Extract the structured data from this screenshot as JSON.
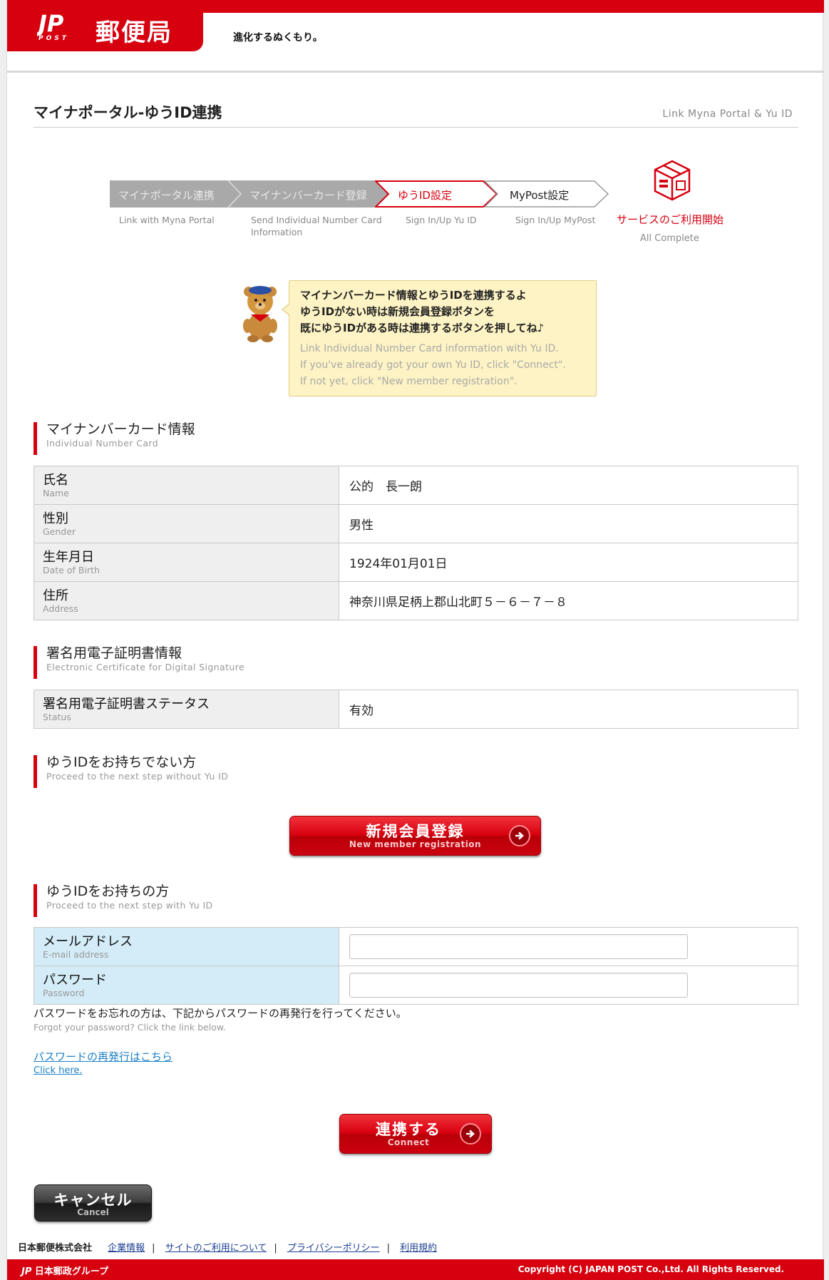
{
  "header": {
    "logo_mark": "JP",
    "logo_post": "POST",
    "brand": "郵便局",
    "slogan": "進化するぬくもり。"
  },
  "page": {
    "title": "マイナポータル-ゆうID連携",
    "subtitle": "Link Myna Portal & Yu ID"
  },
  "steps": [
    {
      "label": "マイナポータル連携",
      "sub": "Link with Myna Portal",
      "state": "done"
    },
    {
      "label": "マイナンバーカード登録",
      "sub": "Send Individual Number Card Information",
      "state": "done"
    },
    {
      "label": "ゆうID設定",
      "sub": "Sign In/Up Yu ID",
      "state": "current"
    },
    {
      "label": "MyPost設定",
      "sub": "Sign In/Up MyPost",
      "state": "todo"
    }
  ],
  "final_step": {
    "label": "サービスのご利用開始",
    "sub": "All Complete"
  },
  "bubble": {
    "jp": [
      "マイナンバーカード情報とゆうIDを連携するよ",
      "ゆうIDがない時は新規会員登録ボタンを",
      "既にゆうIDがある時は連携するボタンを押してね♪"
    ],
    "en": [
      "Link Individual Number Card information with Yu ID.",
      "If you've already got your own Yu ID, click \"Connect\".",
      "If not yet, click \"New member registration\"."
    ]
  },
  "card_section": {
    "title": "マイナンバーカード情報",
    "title_en": "Individual Number Card",
    "rows": [
      {
        "label": "氏名",
        "label_en": "Name",
        "value": "公的　長一朗"
      },
      {
        "label": "性別",
        "label_en": "Gender",
        "value": "男性"
      },
      {
        "label": "生年月日",
        "label_en": "Date of Birth",
        "value": "1924年01月01日"
      },
      {
        "label": "住所",
        "label_en": "Address",
        "value": "神奈川県足柄上郡山北町５－６－７－８"
      }
    ]
  },
  "cert_section": {
    "title": "署名用電子証明書情報",
    "title_en": "Electronic Certificate for Digital Signature",
    "rows": [
      {
        "label": "署名用電子証明書ステータス",
        "label_en": "Status",
        "value": "有効"
      }
    ]
  },
  "no_id_section": {
    "title": "ゆうIDをお持ちでない方",
    "title_en": "Proceed to the next step without Yu ID",
    "button_jp": "新規会員登録",
    "button_en": "New member registration"
  },
  "has_id_section": {
    "title": "ゆうIDをお持ちの方",
    "title_en": "Proceed to the next step with Yu ID",
    "email_label": "メールアドレス",
    "email_label_en": "E-mail address",
    "email_value": "",
    "password_label": "パスワード",
    "password_label_en": "Password",
    "password_value": "",
    "forgot_jp": "パスワードをお忘れの方は、下記からパスワードの再発行を行ってください。",
    "forgot_en": "Forgot your password? Click the link below.",
    "reset_link_jp": "パスワードの再発行はこちら",
    "reset_link_en": "Click here.",
    "connect_jp": "連携する",
    "connect_en": "Connect"
  },
  "cancel": {
    "jp": "キャンセル",
    "en": "Cancel"
  },
  "footer": {
    "company": "日本郵便株式会社",
    "links": [
      "企業情報",
      "サイトのご利用について",
      "プライバシーポリシー",
      "利用規約"
    ],
    "group": "日本郵政グループ",
    "copyright": "Copyright (C) JAPAN POST Co.,Ltd.  All Rights Reserved."
  },
  "colors": {
    "brand_red": "#d6000f",
    "link_blue": "#1c80c7",
    "bubble_bg": "#fdf3c4",
    "input_label_bg": "#d3ecf7"
  }
}
